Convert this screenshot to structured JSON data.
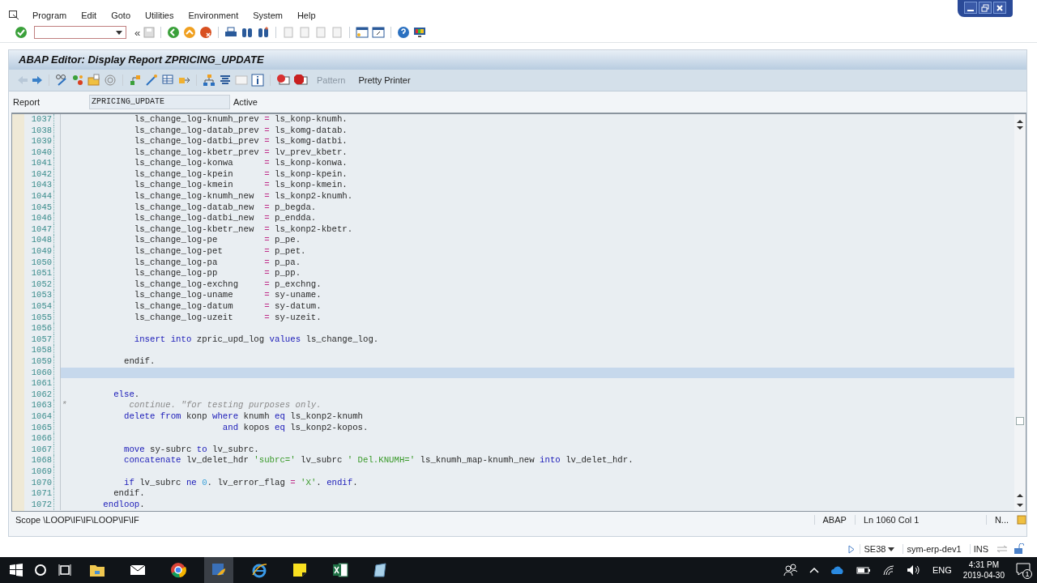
{
  "menu": [
    "Program",
    "Edit",
    "Goto",
    "Utilities",
    "Environment",
    "System",
    "Help"
  ],
  "history_toggle": "«",
  "title": "ABAP Editor: Display Report ZPRICING_UPDATE",
  "app_toolbar": [
    {
      "label": "Pattern",
      "disabled": true
    },
    {
      "label": "Pretty Printer",
      "disabled": false
    }
  ],
  "report": {
    "label": "Report",
    "value": "ZPRICING_UPDATE",
    "status": "Active"
  },
  "editor": {
    "lines": [
      {
        "number": "1037",
        "current": false,
        "tokens": [
          {
            "kind": "plain",
            "text": "              ls_change_log-knumh_prev "
          },
          {
            "kind": "op",
            "text": "="
          },
          {
            "kind": "plain",
            "text": " ls_konp-knumh."
          }
        ]
      },
      {
        "number": "1038",
        "current": false,
        "tokens": [
          {
            "kind": "plain",
            "text": "              ls_change_log-datab_prev "
          },
          {
            "kind": "op",
            "text": "="
          },
          {
            "kind": "plain",
            "text": " ls_komg-datab."
          }
        ]
      },
      {
        "number": "1039",
        "current": false,
        "tokens": [
          {
            "kind": "plain",
            "text": "              ls_change_log-datbi_prev "
          },
          {
            "kind": "op",
            "text": "="
          },
          {
            "kind": "plain",
            "text": " ls_komg-datbi."
          }
        ]
      },
      {
        "number": "1040",
        "current": false,
        "tokens": [
          {
            "kind": "plain",
            "text": "              ls_change_log-kbetr_prev "
          },
          {
            "kind": "op",
            "text": "="
          },
          {
            "kind": "plain",
            "text": " lv_prev_kbetr."
          }
        ]
      },
      {
        "number": "1041",
        "current": false,
        "tokens": [
          {
            "kind": "plain",
            "text": "              ls_change_log-konwa      "
          },
          {
            "kind": "op",
            "text": "="
          },
          {
            "kind": "plain",
            "text": " ls_konp-konwa."
          }
        ]
      },
      {
        "number": "1042",
        "current": false,
        "tokens": [
          {
            "kind": "plain",
            "text": "              ls_change_log-kpein      "
          },
          {
            "kind": "op",
            "text": "="
          },
          {
            "kind": "plain",
            "text": " ls_konp-kpein."
          }
        ]
      },
      {
        "number": "1043",
        "current": false,
        "tokens": [
          {
            "kind": "plain",
            "text": "              ls_change_log-kmein      "
          },
          {
            "kind": "op",
            "text": "="
          },
          {
            "kind": "plain",
            "text": " ls_konp-kmein."
          }
        ]
      },
      {
        "number": "1044",
        "current": false,
        "tokens": [
          {
            "kind": "plain",
            "text": "              ls_change_log-knumh_new  "
          },
          {
            "kind": "op",
            "text": "="
          },
          {
            "kind": "plain",
            "text": " ls_konp2-knumh."
          }
        ]
      },
      {
        "number": "1045",
        "current": false,
        "tokens": [
          {
            "kind": "plain",
            "text": "              ls_change_log-datab_new  "
          },
          {
            "kind": "op",
            "text": "="
          },
          {
            "kind": "plain",
            "text": " p_begda."
          }
        ]
      },
      {
        "number": "1046",
        "current": false,
        "tokens": [
          {
            "kind": "plain",
            "text": "              ls_change_log-datbi_new  "
          },
          {
            "kind": "op",
            "text": "="
          },
          {
            "kind": "plain",
            "text": " p_endda."
          }
        ]
      },
      {
        "number": "1047",
        "current": false,
        "tokens": [
          {
            "kind": "plain",
            "text": "              ls_change_log-kbetr_new  "
          },
          {
            "kind": "op",
            "text": "="
          },
          {
            "kind": "plain",
            "text": " ls_konp2-kbetr."
          }
        ]
      },
      {
        "number": "1048",
        "current": false,
        "tokens": [
          {
            "kind": "plain",
            "text": "              ls_change_log-pe         "
          },
          {
            "kind": "op",
            "text": "="
          },
          {
            "kind": "plain",
            "text": " p_pe."
          }
        ]
      },
      {
        "number": "1049",
        "current": false,
        "tokens": [
          {
            "kind": "plain",
            "text": "              ls_change_log-pet        "
          },
          {
            "kind": "op",
            "text": "="
          },
          {
            "kind": "plain",
            "text": " p_pet."
          }
        ]
      },
      {
        "number": "1050",
        "current": false,
        "tokens": [
          {
            "kind": "plain",
            "text": "              ls_change_log-pa         "
          },
          {
            "kind": "op",
            "text": "="
          },
          {
            "kind": "plain",
            "text": " p_pa."
          }
        ]
      },
      {
        "number": "1051",
        "current": false,
        "tokens": [
          {
            "kind": "plain",
            "text": "              ls_change_log-pp         "
          },
          {
            "kind": "op",
            "text": "="
          },
          {
            "kind": "plain",
            "text": " p_pp."
          }
        ]
      },
      {
        "number": "1052",
        "current": false,
        "tokens": [
          {
            "kind": "plain",
            "text": "              ls_change_log-exchng     "
          },
          {
            "kind": "op",
            "text": "="
          },
          {
            "kind": "plain",
            "text": " p_exchng."
          }
        ]
      },
      {
        "number": "1053",
        "current": false,
        "tokens": [
          {
            "kind": "plain",
            "text": "              ls_change_log-uname      "
          },
          {
            "kind": "op",
            "text": "="
          },
          {
            "kind": "plain",
            "text": " sy-uname."
          }
        ]
      },
      {
        "number": "1054",
        "current": false,
        "tokens": [
          {
            "kind": "plain",
            "text": "              ls_change_log-datum      "
          },
          {
            "kind": "op",
            "text": "="
          },
          {
            "kind": "plain",
            "text": " sy-datum."
          }
        ]
      },
      {
        "number": "1055",
        "current": false,
        "tokens": [
          {
            "kind": "plain",
            "text": "              ls_change_log-uzeit      "
          },
          {
            "kind": "op",
            "text": "="
          },
          {
            "kind": "plain",
            "text": " sy-uzeit."
          }
        ]
      },
      {
        "number": "1056",
        "current": false
      },
      {
        "number": "1057",
        "current": false,
        "tokens": [
          {
            "kind": "kw",
            "text": "              insert"
          },
          {
            "kind": "kw",
            "text": " into"
          },
          {
            "kind": "plain",
            "text": " zpric_upd_log "
          },
          {
            "kind": "kw",
            "text": "values"
          },
          {
            "kind": "plain",
            "text": " ls_change_log."
          }
        ]
      },
      {
        "number": "1058",
        "current": false
      },
      {
        "number": "1059",
        "current": false,
        "tokens": [
          {
            "kind": "plain",
            "text": "            endif."
          }
        ]
      },
      {
        "number": "1060",
        "current": true
      },
      {
        "number": "1061",
        "current": false
      },
      {
        "number": "1062",
        "current": false,
        "tokens": [
          {
            "kind": "kw",
            "text": "          else"
          },
          {
            "kind": "plain",
            "text": "."
          }
        ]
      },
      {
        "number": "1063",
        "current": false,
        "tokens": [
          {
            "kind": "comment",
            "text": "*            continue. \"for testing purposes only."
          }
        ]
      },
      {
        "number": "1064",
        "current": false,
        "tokens": [
          {
            "kind": "kw",
            "text": "            delete"
          },
          {
            "kind": "kw",
            "text": " from"
          },
          {
            "kind": "plain",
            "text": " konp "
          },
          {
            "kind": "kw",
            "text": "where"
          },
          {
            "kind": "plain",
            "text": " knumh "
          },
          {
            "kind": "kw",
            "text": "eq"
          },
          {
            "kind": "plain",
            "text": " ls_konp2-knumh"
          }
        ]
      },
      {
        "number": "1065",
        "current": false,
        "tokens": [
          {
            "kind": "kw",
            "text": "                               and"
          },
          {
            "kind": "plain",
            "text": " kopos "
          },
          {
            "kind": "kw",
            "text": "eq"
          },
          {
            "kind": "plain",
            "text": " ls_konp2-kopos."
          }
        ]
      },
      {
        "number": "1066",
        "current": false
      },
      {
        "number": "1067",
        "current": false,
        "tokens": [
          {
            "kind": "kw",
            "text": "            move"
          },
          {
            "kind": "plain",
            "text": " sy-subrc "
          },
          {
            "kind": "kw",
            "text": "to"
          },
          {
            "kind": "plain",
            "text": " lv_subrc."
          }
        ]
      },
      {
        "number": "1068",
        "current": false,
        "tokens": [
          {
            "kind": "kw",
            "text": "            concatenate"
          },
          {
            "kind": "plain",
            "text": " lv_delet_hdr "
          },
          {
            "kind": "str",
            "text": "'subrc='"
          },
          {
            "kind": "plain",
            "text": " lv_subrc "
          },
          {
            "kind": "str",
            "text": "' Del.KNUMH='"
          },
          {
            "kind": "plain",
            "text": " ls_knumh_map-knumh_new "
          },
          {
            "kind": "kw",
            "text": "into"
          },
          {
            "kind": "plain",
            "text": " lv_delet_hdr."
          }
        ]
      },
      {
        "number": "1069",
        "current": false
      },
      {
        "number": "1070",
        "current": false,
        "tokens": [
          {
            "kind": "kw",
            "text": "            if"
          },
          {
            "kind": "plain",
            "text": " lv_subrc "
          },
          {
            "kind": "kw",
            "text": "ne"
          },
          {
            "kind": "num",
            "text": " 0"
          },
          {
            "kind": "plain",
            "text": ". lv_error_flag "
          },
          {
            "kind": "op",
            "text": "="
          },
          {
            "kind": "str",
            "text": " 'X'"
          },
          {
            "kind": "plain",
            "text": ". "
          },
          {
            "kind": "kw",
            "text": "endif"
          },
          {
            "kind": "plain",
            "text": "."
          }
        ]
      },
      {
        "number": "1071",
        "current": false,
        "tokens": [
          {
            "kind": "plain",
            "text": "          endif."
          }
        ]
      },
      {
        "number": "1072",
        "current": false,
        "tokens": [
          {
            "kind": "kw",
            "text": "        endloop"
          },
          {
            "kind": "plain",
            "text": "."
          }
        ]
      }
    ]
  },
  "status_line": {
    "scope": "Scope \\LOOP\\IF\\IF\\LOOP\\IF\\IF",
    "language": "ABAP",
    "position": "Ln 1060 Col  1",
    "mode": "N..."
  },
  "status_bar": {
    "transaction": "SE38",
    "system": "sym-erp-dev1",
    "mode": "INS"
  },
  "taskbar": {
    "language": "ENG",
    "time": "4:31 PM",
    "date": "2019-04-30",
    "notifications": "1"
  }
}
